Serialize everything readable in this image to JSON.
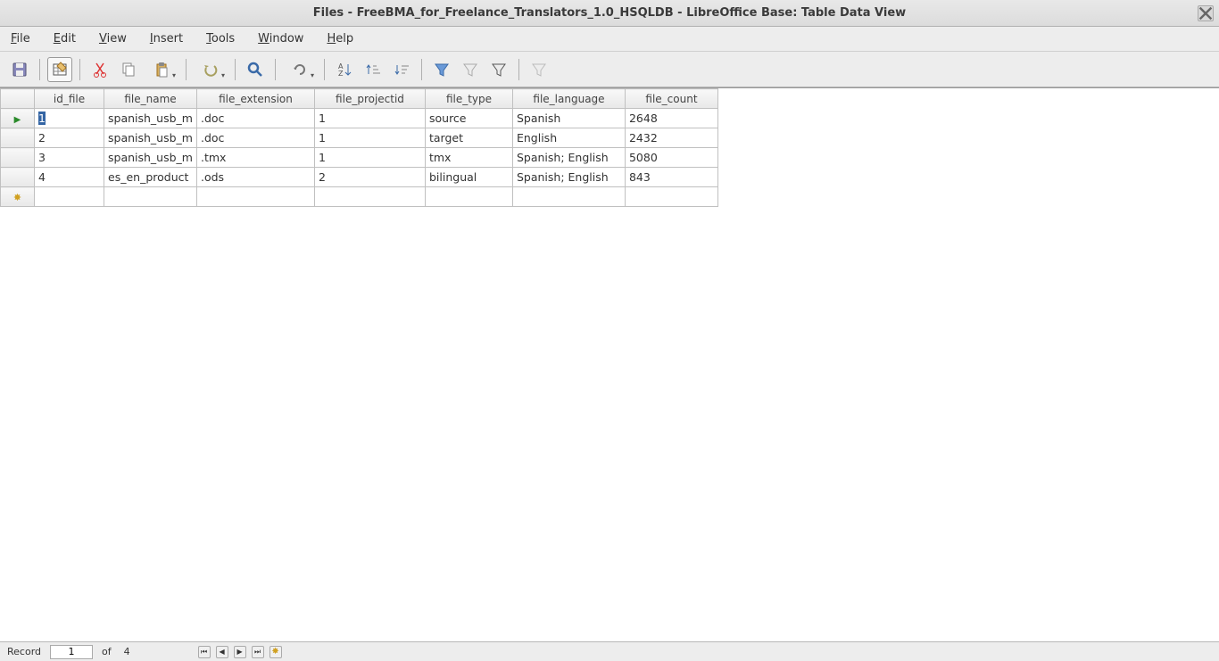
{
  "titlebar": {
    "title": "Files - FreeBMA_for_Freelance_Translators_1.0_HSQLDB - LibreOffice Base: Table Data View"
  },
  "menu": {
    "file": "File",
    "edit": "Edit",
    "view": "View",
    "insert": "Insert",
    "tools": "Tools",
    "window": "Window",
    "help": "Help"
  },
  "columns": {
    "id_file": "id_file",
    "file_name": "file_name",
    "file_extension": "file_extension",
    "file_projectid": "file_projectid",
    "file_type": "file_type",
    "file_language": "file_language",
    "file_count": "file_count"
  },
  "rows": [
    {
      "id_file": "1",
      "file_name": "spanish_usb_m",
      "file_extension": ".doc",
      "file_projectid": "1",
      "file_type": "source",
      "file_language": "Spanish",
      "file_count": "2648"
    },
    {
      "id_file": "2",
      "file_name": "spanish_usb_m",
      "file_extension": ".doc",
      "file_projectid": "1",
      "file_type": "target",
      "file_language": "English",
      "file_count": "2432"
    },
    {
      "id_file": "3",
      "file_name": "spanish_usb_m",
      "file_extension": ".tmx",
      "file_projectid": "1",
      "file_type": "tmx",
      "file_language": "Spanish; English",
      "file_count": "5080"
    },
    {
      "id_file": "4",
      "file_name": "es_en_product",
      "file_extension": ".ods",
      "file_projectid": "2",
      "file_type": "bilingual",
      "file_language": "Spanish; English",
      "file_count": "843"
    }
  ],
  "status": {
    "record_label": "Record",
    "current": "1",
    "of_label": "of",
    "total": "4"
  }
}
